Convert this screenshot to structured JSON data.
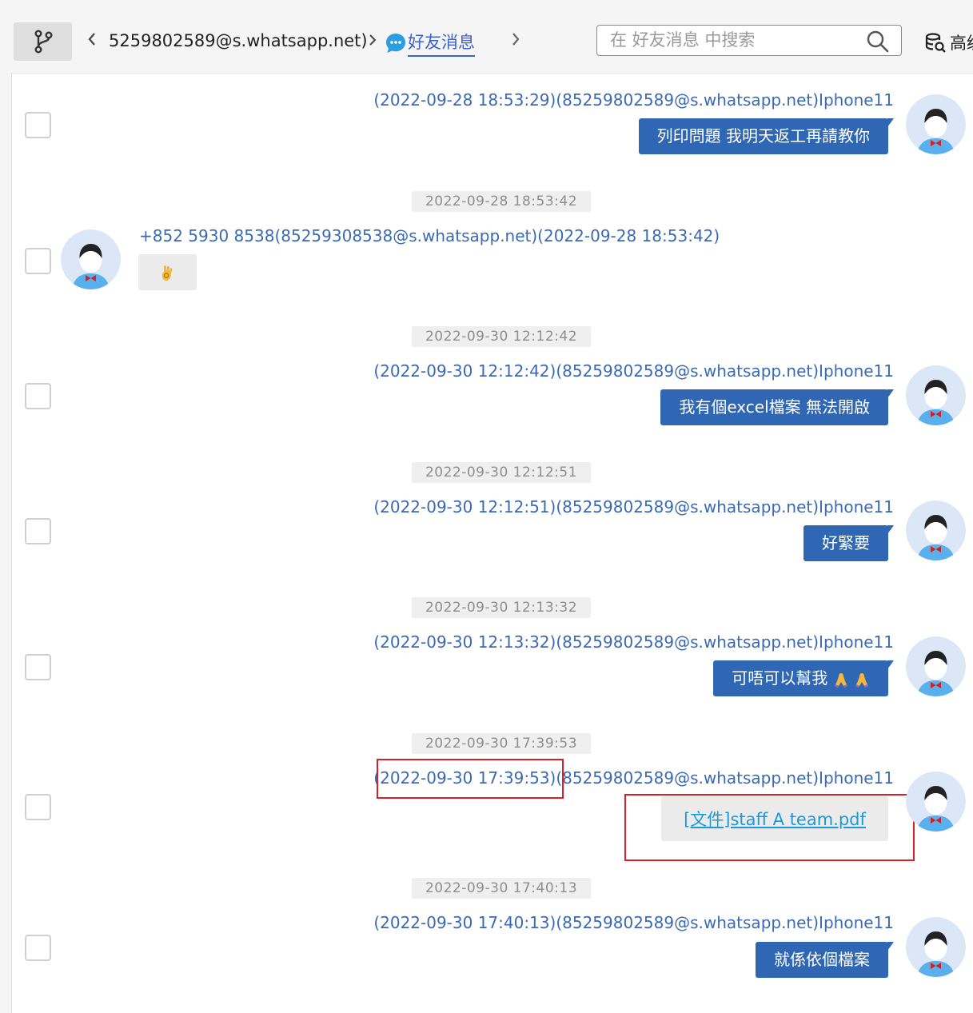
{
  "toolbar": {
    "breadcrumb_contact": "5259802589@s.whatsapp.net)",
    "breadcrumb_tab": "好友消息",
    "search_placeholder": "在 好友消息 中搜索",
    "advanced_label": "高级"
  },
  "messages": [
    {
      "direction": "right",
      "header": "(2022-09-28 18:53:29)(85259802589@s.whatsapp.net)Iphone11",
      "text": "列印問題 我明天返工再請教你"
    },
    {
      "separator": "2022-09-28 18:53:42",
      "direction": "left",
      "header": "+852 5930 8538(85259308538@s.whatsapp.net)(2022-09-28 18:53:42)",
      "emoji": "ok-hand"
    },
    {
      "separator": "2022-09-30 12:12:42",
      "direction": "right",
      "header": "(2022-09-30 12:12:42)(85259802589@s.whatsapp.net)Iphone11",
      "text": "我有個excel檔案 無法開啟"
    },
    {
      "separator": "2022-09-30 12:12:51",
      "direction": "right",
      "header": "(2022-09-30 12:12:51)(85259802589@s.whatsapp.net)Iphone11",
      "text": "好緊要"
    },
    {
      "separator": "2022-09-30 12:13:32",
      "direction": "right",
      "header": "(2022-09-30 12:13:32)(85259802589@s.whatsapp.net)Iphone11",
      "text": "可唔可以幫我"
    },
    {
      "separator": "2022-09-30 17:39:53",
      "direction": "right",
      "header_time": "(2022-09-30 17:39:53)",
      "header_rest": "(85259802589@s.whatsapp.net)Iphone11",
      "file_link": "[文件]staff A team.pdf"
    },
    {
      "separator": "2022-09-30 17:40:13",
      "direction": "right",
      "header": "(2022-09-30 17:40:13)(85259802589@s.whatsapp.net)Iphone11",
      "text": "就係依個檔案"
    }
  ],
  "colors": {
    "accent_blue": "#2f67b5",
    "sender_blue": "#3a6ab3",
    "highlight_red": "#d8202c",
    "link_blue": "#1a9ad6"
  }
}
